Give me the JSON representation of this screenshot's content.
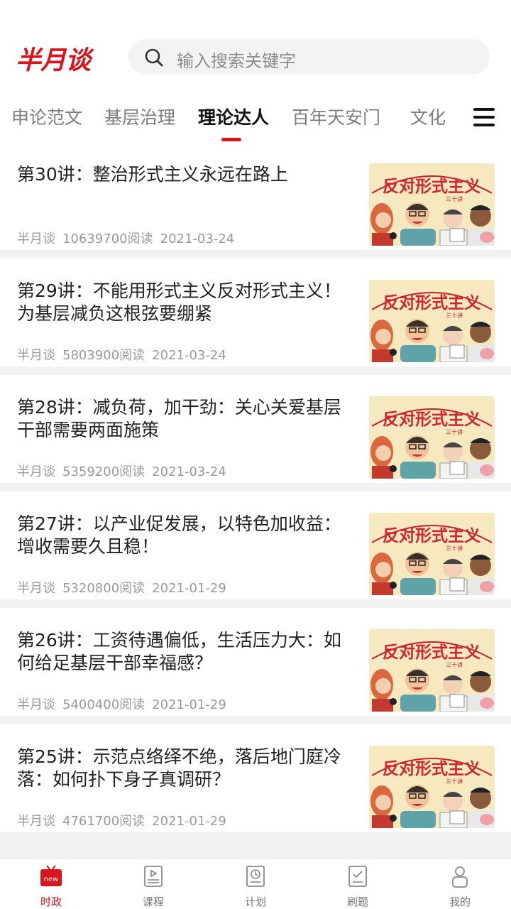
{
  "header": {
    "logo_text": "半月谈",
    "search_placeholder": "输入搜索关键字"
  },
  "tabs": [
    {
      "label": "申论范文",
      "active": false
    },
    {
      "label": "基层治理",
      "active": false
    },
    {
      "label": "理论达人",
      "active": true
    },
    {
      "label": "百年天安门",
      "active": false
    },
    {
      "label": "文化",
      "active": false
    }
  ],
  "articles": [
    {
      "title": "第30讲：整治形式主义永远在路上",
      "source": "半月谈",
      "reads": "10639700阅读",
      "date": "2021-03-24"
    },
    {
      "title": "第29讲：不能用形式主义反对形式主义！为基层减负这根弦要绷紧",
      "source": "半月谈",
      "reads": "5803900阅读",
      "date": "2021-03-24"
    },
    {
      "title": "第28讲：减负荷，加干劲：关心关爱基层干部需要两面施策",
      "source": "半月谈",
      "reads": "5359200阅读",
      "date": "2021-03-24"
    },
    {
      "title": "第27讲：以产业促发展，以特色加收益：增收需要久且稳！",
      "source": "半月谈",
      "reads": "5320800阅读",
      "date": "2021-01-29"
    },
    {
      "title": "第26讲：工资待遇偏低，生活压力大：如何给足基层干部幸福感？",
      "source": "半月谈",
      "reads": "5400400阅读",
      "date": "2021-01-29"
    },
    {
      "title": "第25讲：示范点络绎不绝，落后地门庭冷落：如何扑下身子真调研？",
      "source": "半月谈",
      "reads": "4761700阅读",
      "date": "2021-01-29"
    }
  ],
  "thumbnail": {
    "banner_text": "反对形式主义",
    "sub_text": "三十讲"
  },
  "bottom_nav": [
    {
      "label": "时政",
      "icon": "news-icon",
      "badge": "new",
      "active": true
    },
    {
      "label": "课程",
      "icon": "course-icon",
      "active": false
    },
    {
      "label": "计划",
      "icon": "plan-icon",
      "active": false
    },
    {
      "label": "刷题",
      "icon": "quiz-icon",
      "active": false
    },
    {
      "label": "我的",
      "icon": "profile-icon",
      "active": false
    }
  ],
  "colors": {
    "accent": "#d8141c"
  }
}
